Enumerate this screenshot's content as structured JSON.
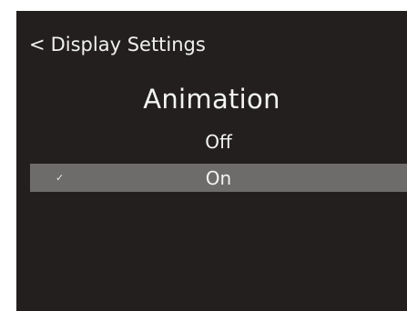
{
  "header": {
    "back_glyph": "<",
    "back_label": "Display Settings"
  },
  "title": "Animation",
  "options": [
    {
      "label": "Off",
      "selected": false
    },
    {
      "label": "On",
      "selected": true,
      "check_glyph": "✓"
    }
  ],
  "colors": {
    "background": "#221f1e",
    "text": "#f2f2f2",
    "selected_row": "#6e6c6b"
  }
}
